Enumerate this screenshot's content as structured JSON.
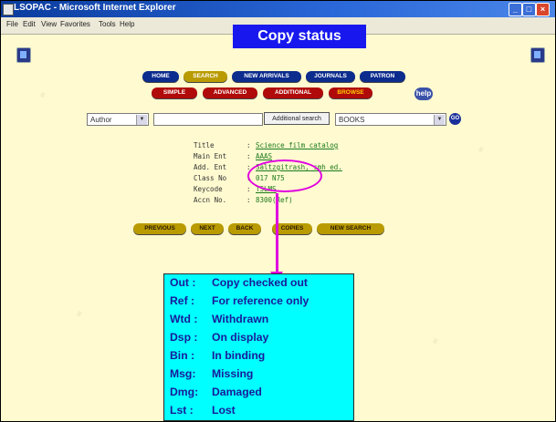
{
  "window": {
    "title": "LSOPAC - Microsoft Internet Explorer",
    "min_glyph": "_",
    "max_glyph": "□",
    "close_glyph": "×"
  },
  "menu": [
    "File",
    "Edit",
    "View",
    "Favorites",
    "Tools",
    "Help"
  ],
  "overlay_title": "Copy status",
  "nav_row1": [
    "HOME",
    "SEARCH",
    "NEW ARRIVALS",
    "JOURNALS",
    "PATRON"
  ],
  "nav_row2": [
    "SIMPLE",
    "ADVANCED",
    "ADDITIONAL",
    "BROWSE"
  ],
  "help_label": "help",
  "search": {
    "field_select": "Author",
    "query": "",
    "advanced_button": "Additional search",
    "collection_select": "BOOKS",
    "go_label": "GO"
  },
  "record": [
    {
      "label": "Title",
      "value": "Science film catalog"
    },
    {
      "label": "Main Ent",
      "value": "AAAS"
    },
    {
      "label": "Add. Ent",
      "value": "Saltzgitrash, smh ed."
    },
    {
      "label": "Class No",
      "value": "017 N75"
    },
    {
      "label": "Keycode",
      "value": "TSLMS"
    },
    {
      "label": "Accn No.",
      "value": "8300(Ref)"
    }
  ],
  "record_separator": ":",
  "action_buttons": [
    "PREVIOUS",
    "NEXT",
    "BACK",
    "COPIES",
    "NEW SEARCH"
  ],
  "legend": [
    {
      "code": "Out :",
      "meaning": "Copy checked out"
    },
    {
      "code": "Ref :",
      "meaning": "For reference only"
    },
    {
      "code": "Wtd :",
      "meaning": "Withdrawn"
    },
    {
      "code": "Dsp :",
      "meaning": "On display"
    },
    {
      "code": "Bin :",
      "meaning": "In binding"
    },
    {
      "code": "Msg:",
      "meaning": "Missing"
    },
    {
      "code": "Dmg:",
      "meaning": "Damaged"
    },
    {
      "code": "Lst :",
      "meaning": "Lost"
    }
  ],
  "colors": {
    "overlay_title_bg": "#1818ee",
    "legend_bg": "#00ffff",
    "callout": "#e000e0",
    "page_bg": "#fffad0"
  }
}
